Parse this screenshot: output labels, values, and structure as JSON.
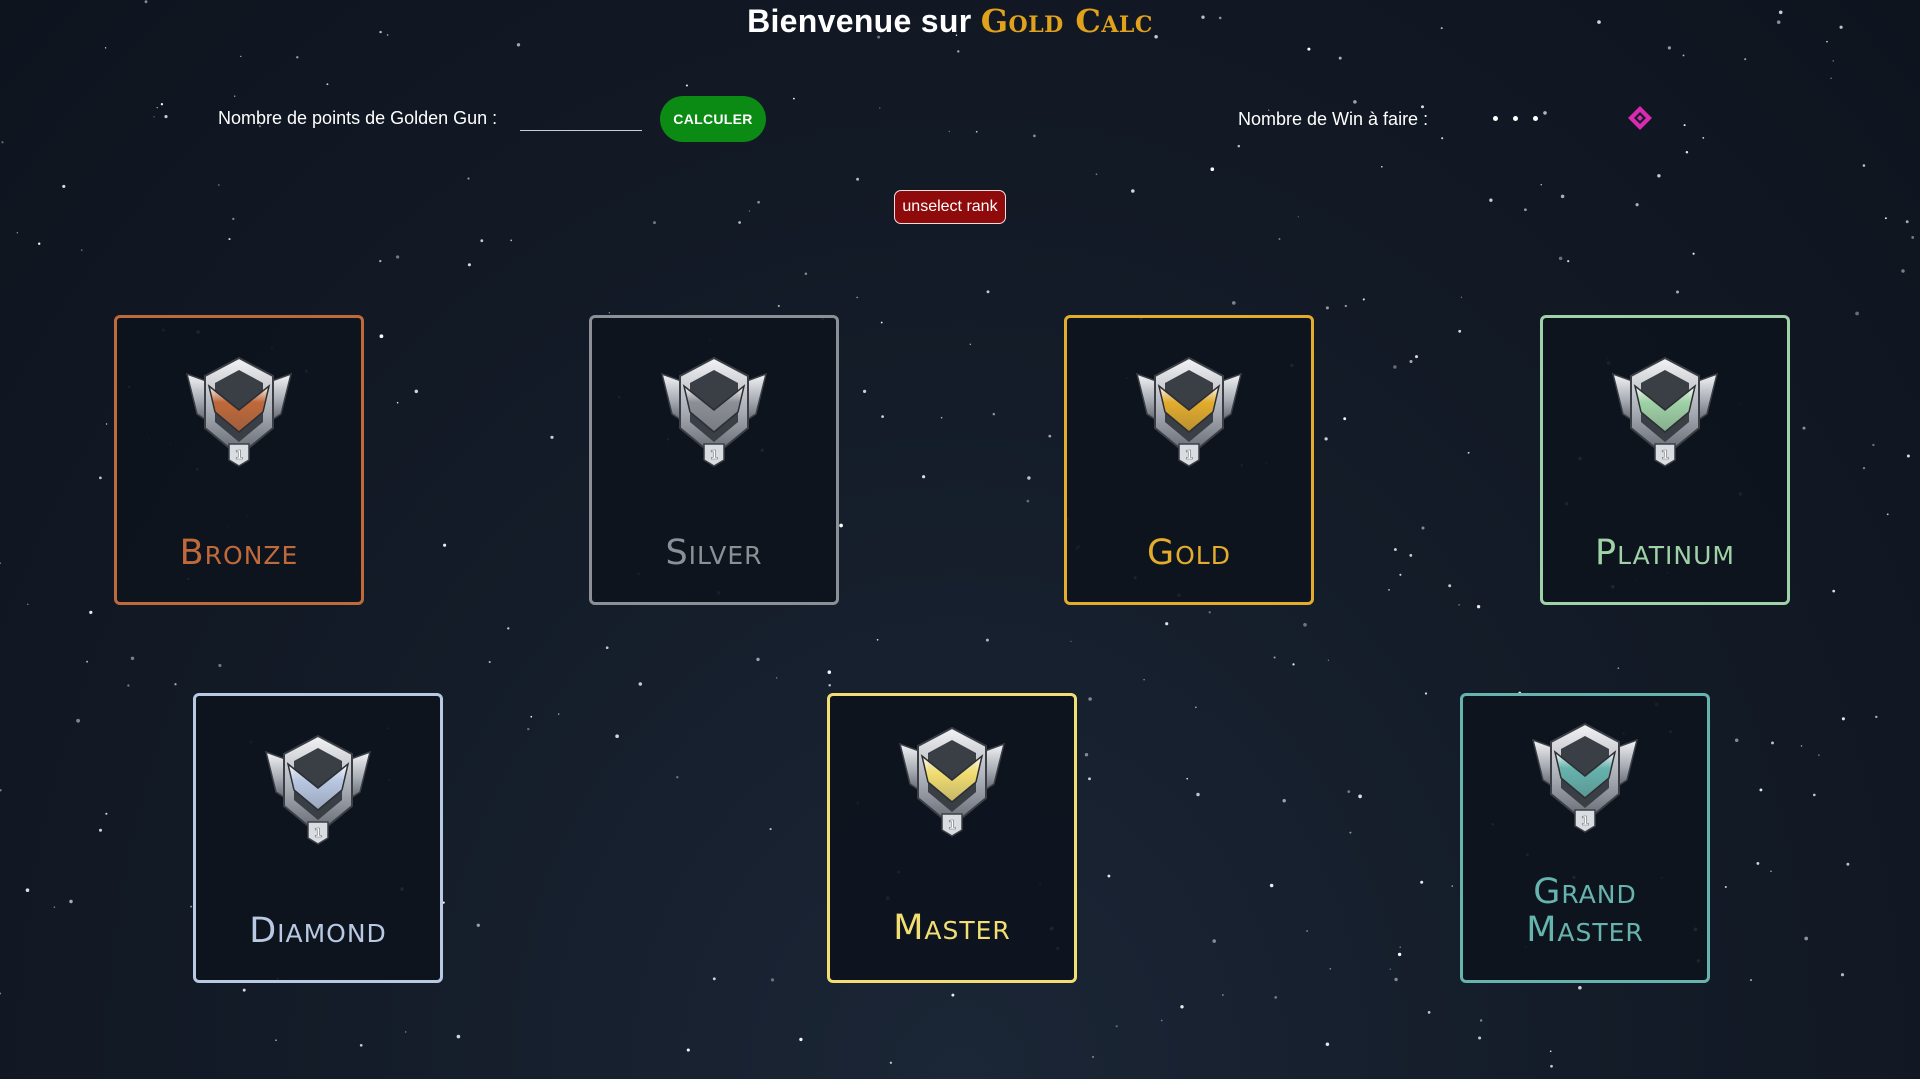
{
  "header": {
    "title_prefix": "Bienvenue sur",
    "brand": "Gold Calc"
  },
  "controls": {
    "points_label": "Nombre de points de Golden Gun :",
    "points_value": "",
    "calculate_label": "CALCULER",
    "wins_label": "Nombre de Win à faire :",
    "unselect_label": "unselect rank"
  },
  "ranks": [
    {
      "name": "Bronze",
      "tier": "1",
      "color": "#c0693a",
      "icon": "bronze-rank-icon"
    },
    {
      "name": "Silver",
      "tier": "1",
      "color": "#8c9096",
      "icon": "silver-rank-icon"
    },
    {
      "name": "Gold",
      "tier": "1",
      "color": "#e3ac2c",
      "icon": "gold-rank-icon"
    },
    {
      "name": "Platinum",
      "tier": "1",
      "color": "#9fd2a6",
      "icon": "platinum-rank-icon"
    },
    {
      "name": "Diamond",
      "tier": "1",
      "color": "#b9c8e3",
      "icon": "diamond-rank-icon"
    },
    {
      "name": "Master",
      "tier": "1",
      "color": "#f2de72",
      "icon": "master-rank-icon"
    },
    {
      "name": "Grand Master",
      "tier": "1",
      "color": "#67b3ae",
      "icon": "grand-master-rank-icon"
    }
  ],
  "colors": {
    "background": "#141c29",
    "brand": "#e0a21b",
    "calculate_button": "#0b8a14",
    "unselect_button": "#8f0a0a",
    "loader": "#d92bb0"
  }
}
